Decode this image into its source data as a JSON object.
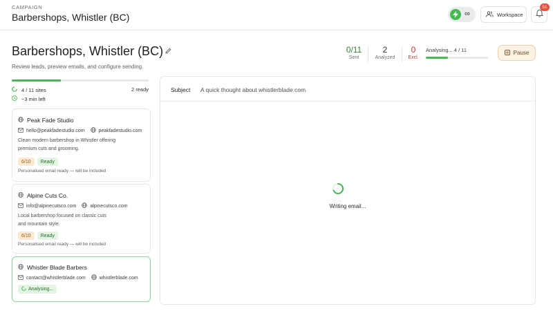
{
  "header": {
    "breadcrumb": "CAMPAIGN",
    "title": "Barbershops, Whistler (BC)",
    "credits": {
      "icon": "bolt-icon",
      "value": "∞"
    },
    "workspace_label": "Workspace",
    "notifications_count": "51"
  },
  "campaign": {
    "title": "Barbershops, Whistler (BC)",
    "subtitle": "Review leads, preview emails, and configure sending.",
    "stats": {
      "sent_value": "0/11",
      "sent_label": "Sent",
      "analyzed_value": "2",
      "analyzed_label": "Analyzed",
      "excluded_value": "0",
      "excluded_label": "Excl."
    },
    "analysing_text": "Analysing... 4 / 11",
    "analysing_progress": 0.36,
    "pause_label": "Pause"
  },
  "sites": {
    "progress_text": "4 / 11 sites",
    "progress": 0.36,
    "ready_text": "2 ready",
    "time_left": "~3 min left"
  },
  "leads": [
    {
      "name": "Peak Fade Studio",
      "email": "hello@peakfadestudio.com",
      "website": "peakfadestudio.com",
      "description": [
        "Clean modern barbershop in Whistler offering",
        "premium cuts and grooming."
      ],
      "score": "6/10",
      "status": "Ready",
      "note": "Personalised email ready — will be included"
    },
    {
      "name": "Alpine Cuts Co.",
      "email": "info@alpinecutsco.com",
      "website": "alpinecutsco.com",
      "description": [
        "Local barbershop focused on classic cuts",
        "and mountain style."
      ],
      "score": "6/10",
      "status": "Ready",
      "note": "Personalised email ready — will be included"
    },
    {
      "name": "Whistler Blade Barbers",
      "email": "contact@whistlerblade.com",
      "website": "whistlerblade.com",
      "status": "Analysing..."
    }
  ],
  "preview": {
    "subject_label": "Subject",
    "subject_value": "A quick thought about whistlerblade.com",
    "status_text": "Writing email..."
  },
  "colors": {
    "accent_green": "#49b854",
    "excluded_red": "#c0392b",
    "sent_green": "#2e7d32"
  }
}
